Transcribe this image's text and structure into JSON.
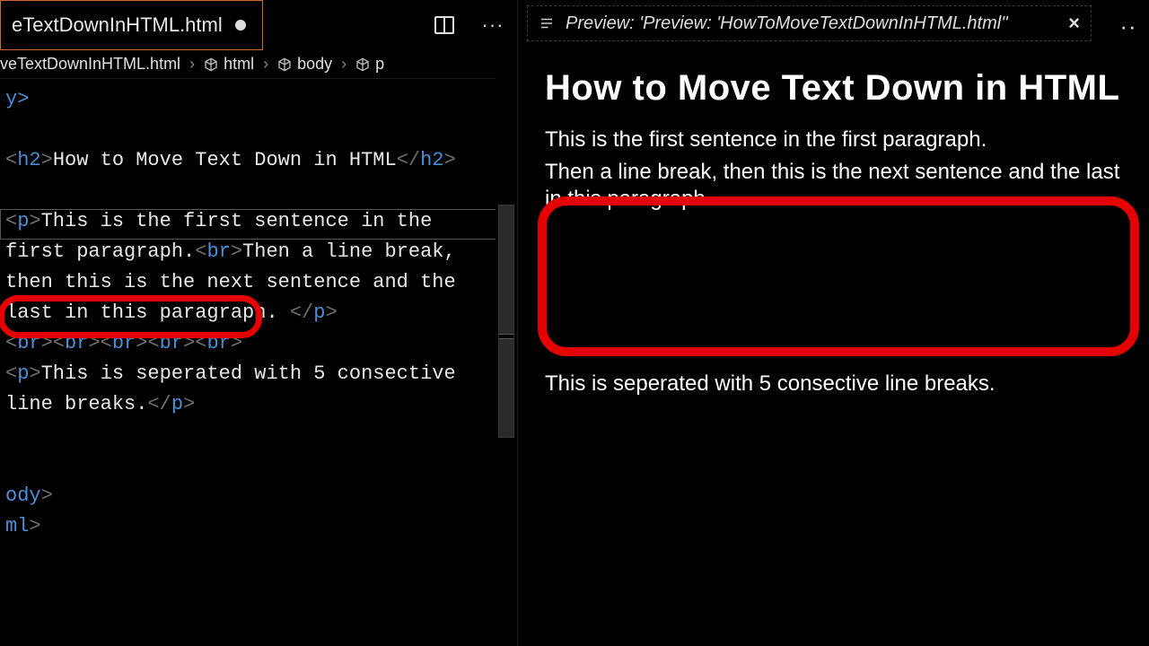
{
  "left": {
    "tab": {
      "filename": "eTextDownInHTML.html",
      "modified": true
    },
    "crumbs": {
      "file": "veTextDownInHTML.html",
      "html": "html",
      "body": "body",
      "p": "p"
    },
    "code": {
      "line_cursor": "y>",
      "h2_open": "<",
      "h2_tag": "h2",
      "h2_close_a": ">",
      "h2_text": "How to Move Text Down in HTML",
      "h2_end1": "</",
      "h2_end2": "h2",
      "h2_end3": ">",
      "p1_open": "<",
      "p1_tag": "p",
      "p1_close": ">",
      "p1_text_a": "This is the first sentence in the ",
      "p1_text_b": "first paragraph.",
      "br_open": "<",
      "br_tag": "br",
      "br_close": ">",
      "p1_text_c": "Then a line break, ",
      "p1_text_d": "then this is the next sentence and the ",
      "p1_text_e": "last in this paragraph. ",
      "p1_end1": "</",
      "p1_end2": "p",
      "p1_end3": ">",
      "brs": "<br><br><br><br><br>",
      "p2_open": "<",
      "p2_tag": "p",
      "p2_close": ">",
      "p2_text_a": "This is seperated with 5 consective ",
      "p2_text_b": "line breaks.",
      "p2_end1": "</",
      "p2_end2": "p",
      "p2_end3": ">",
      "body_end": "ody",
      "body_end_gt": ">",
      "html_end": "ml",
      "html_end_gt": ">"
    }
  },
  "right": {
    "previewTitle": "Preview: 'Preview: 'HowToMoveTextDownInHTML.html''",
    "h2": "How to Move Text Down in HTML",
    "p1a": "This is the first sentence in the first paragraph.",
    "p1b": "Then a line break, then this is the next sentence and the last in this paragraph.",
    "p2": "This is seperated with 5 consective line breaks."
  }
}
